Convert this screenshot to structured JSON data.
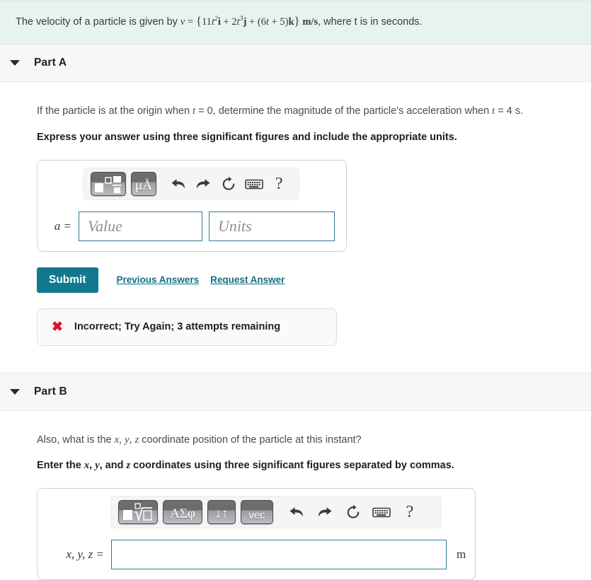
{
  "problem": {
    "text_before": "The velocity of a particle is given by",
    "equation_lhs": "v",
    "equation_eq": "=",
    "equation_body": "{11t²i + 2t³j + (6t + 5)k}",
    "equation_units": "m/s",
    "text_after": ", where t is in seconds.",
    "full_text": "The velocity of a particle is given by v = {11t2i + 2t3j + (6t + 5)k} m/s, where t is in seconds.",
    "banner_color": "#e7f3f1"
  },
  "part_a": {
    "title": "Part A",
    "caret": "caret-down-icon",
    "question": "If the particle is at the origin when t = 0, determine the magnitude of the particle's acceleration when t = 4 s.",
    "question_segments": {
      "s1": "If the particle is at the origin when ",
      "var1": "t",
      "s2": " = 0, determine the magnitude of the particle's acceleration when ",
      "var2": "t",
      "s3": " = 4 s."
    },
    "instruction": "Express your answer using three significant figures and include the appropriate units.",
    "toolbar": {
      "buttons": [
        {
          "name": "template-button",
          "label": "⬜"
        },
        {
          "name": "units-button",
          "label": "μÅ"
        },
        {
          "name": "undo-button",
          "label": "undo-icon"
        },
        {
          "name": "redo-button",
          "label": "redo-icon"
        },
        {
          "name": "reset-button",
          "label": "reset-icon"
        },
        {
          "name": "keyboard-button",
          "label": "keyboard-icon"
        },
        {
          "name": "help-button",
          "label": "?"
        }
      ],
      "units_label": "μÅ",
      "help_label": "?"
    },
    "answer": {
      "label": "a =",
      "value": "",
      "value_placeholder": "Value",
      "units": "",
      "units_placeholder": "Units"
    },
    "actions": {
      "submit": "Submit",
      "previous_answers": "Previous Answers",
      "request_answer": "Request Answer"
    },
    "feedback": {
      "icon": "x-mark-icon",
      "text": "Incorrect; Try Again; 3 attempts remaining",
      "color": "#e0102c"
    }
  },
  "part_b": {
    "title": "Part B",
    "caret": "caret-down-icon",
    "question": "Also, what is the x, y, z coordinate position of the particle at this instant?",
    "question_segments": {
      "s1": "Also, what is the ",
      "var1": "x",
      "sep1": ", ",
      "var2": "y",
      "sep2": ", ",
      "var3": "z",
      "s2": " coordinate position of the particle at this instant?"
    },
    "instruction": "Enter the x, y, and z coordinates using three significant figures separated by commas.",
    "instruction_segments": {
      "s1": "Enter the ",
      "var1": "x",
      "sep1": ", ",
      "var2": "y",
      "sep2": ", and ",
      "var3": "z",
      "s2": " coordinates using three significant figures separated by commas."
    },
    "toolbar": {
      "buttons": [
        {
          "name": "template-button",
          "label": "√"
        },
        {
          "name": "greek-button",
          "label": "ΑΣφ"
        },
        {
          "name": "arrows-button",
          "label": "↓↑"
        },
        {
          "name": "vec-button",
          "label": "vec"
        },
        {
          "name": "undo-button",
          "label": "undo-icon"
        },
        {
          "name": "redo-button",
          "label": "redo-icon"
        },
        {
          "name": "reset-button",
          "label": "reset-icon"
        },
        {
          "name": "keyboard-button",
          "label": "keyboard-icon"
        },
        {
          "name": "help-button",
          "label": "?"
        }
      ],
      "greek_label": "ΑΣφ",
      "arrows_label": "↓↑",
      "vec_label": "vec",
      "help_label": "?"
    },
    "answer": {
      "label": "x, y, z =",
      "value": "",
      "unit_suffix": "m"
    }
  },
  "theme": {
    "accent": "#10798f",
    "link": "#106f86",
    "field_border": "#2e7d91",
    "error": "#e0102c"
  }
}
